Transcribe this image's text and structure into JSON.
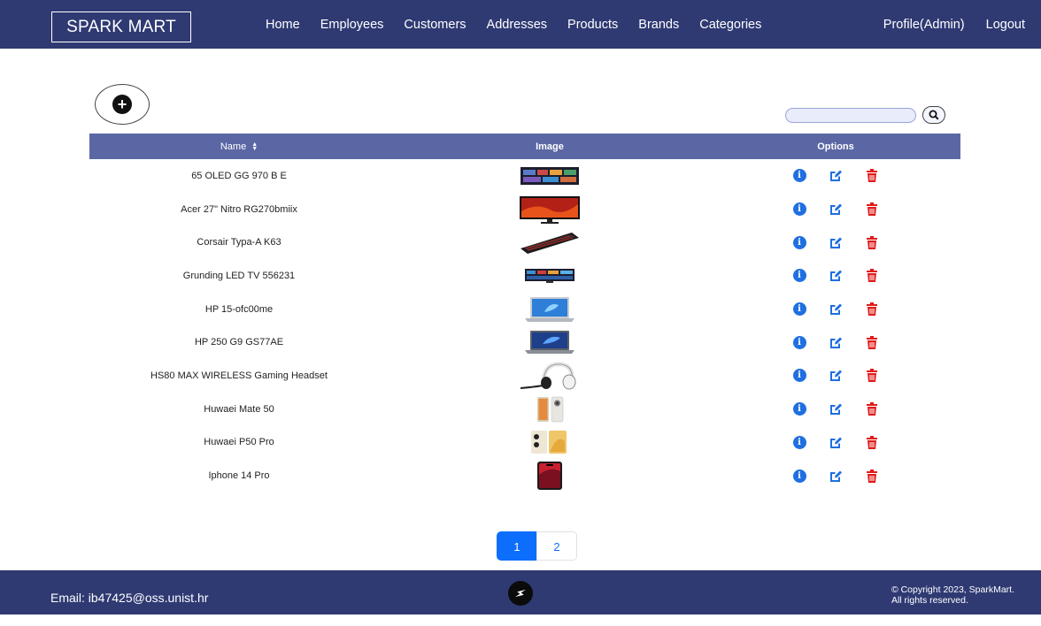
{
  "navbar": {
    "brand": "SPARK MART",
    "links": [
      "Home",
      "Employees",
      "Customers",
      "Addresses",
      "Products",
      "Brands",
      "Categories"
    ],
    "profile": "Profile(Admin)",
    "logout": "Logout"
  },
  "toolbar": {
    "add_icon": "plus-circle-icon",
    "search_icon": "search-icon",
    "search_value": ""
  },
  "table": {
    "headers": {
      "name": "Name",
      "image": "Image",
      "options": "Options"
    },
    "rows": [
      {
        "name": "65 OLED GG 970 B E",
        "image": "tv-image"
      },
      {
        "name": "Acer 27\" Nitro RG270bmiix",
        "image": "monitor-image"
      },
      {
        "name": "Corsair Typa-A K63",
        "image": "keyboard-image"
      },
      {
        "name": "Grunding LED TV 556231",
        "image": "tv-image"
      },
      {
        "name": "HP 15-ofc00me",
        "image": "laptop-image"
      },
      {
        "name": "HP 250 G9 GS77AE",
        "image": "laptop-image"
      },
      {
        "name": "HS80 MAX WIRELESS Gaming Headset",
        "image": "headset-image"
      },
      {
        "name": "Huwaei Mate 50",
        "image": "phone-image"
      },
      {
        "name": "Huwaei P50 Pro",
        "image": "phone-image"
      },
      {
        "name": "Iphone 14 Pro",
        "image": "phone-image"
      }
    ],
    "option_icons": [
      "info-icon",
      "edit-icon",
      "trash-icon"
    ]
  },
  "pagination": {
    "pages": [
      "1",
      "2"
    ],
    "current": "1"
  },
  "footer": {
    "email": "Email: ib47425@oss.unist.hr",
    "copyright_line1": "© Copyright 2023, SparkMart.",
    "copyright_line2": "All rights reserved."
  },
  "colors": {
    "navbar": "#2f3a73",
    "table_header": "#5b67a4",
    "info": "#1f6fe0",
    "edit": "#1f6fe0",
    "delete": "#e01b1b",
    "page_active": "#0d6efd"
  }
}
